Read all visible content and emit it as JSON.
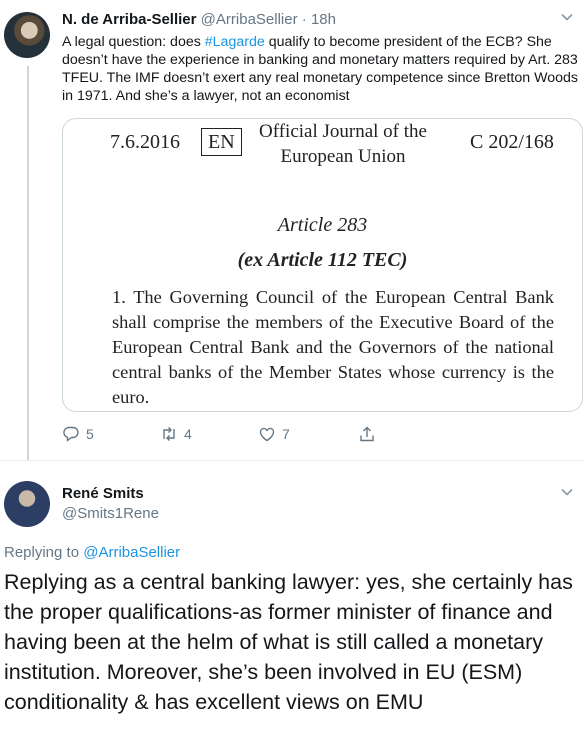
{
  "tweet1": {
    "name": "N. de Arriba-Sellier",
    "handle": "@ArribaSellier",
    "sep": " · ",
    "time": "18h",
    "text_a": "A legal question: does ",
    "hashtag": "#Lagarde",
    "text_b": " qualify to become president of the ECB? She doesn’t have the experience in banking and monetary matters required by Art. 283 TFEU. The IMF doesn’t exert any real monetary competence since Bretton Woods in 1971. And she’s a lawyer, not an economist",
    "image": {
      "date": "7.6.2016",
      "lang": "EN",
      "journal_line1": "Official Journal of the",
      "journal_line2": "European Union",
      "ref": "C 202/168",
      "article": "Article 283",
      "ex_article": "(ex Article 112 TEC)",
      "paragraph": "1.   The Governing Council of the European Central Bank shall comprise the members of the Executive Board of the European Central Bank and the Governors of the national central banks of the Member States whose currency is the euro."
    },
    "actions": {
      "replies": "5",
      "retweets": "4",
      "likes": "7"
    }
  },
  "tweet2": {
    "name": "René Smits",
    "handle": "@Smits1Rene",
    "replying_label": "Replying to ",
    "replying_to": "@ArribaSellier",
    "text": "Replying as a central banking lawyer: yes, she certainly has the proper qualifications-as former minister of finance and having been at the helm of what is still called a monetary institution. Moreover, she’s been involved in EU (ESM) conditionality & has excellent views on EMU"
  },
  "icons": [
    "reply-icon",
    "retweet-icon",
    "like-icon",
    "share-icon",
    "chevron-down-icon"
  ],
  "colors": {
    "link": "#1b95e0",
    "muted": "#657786",
    "border": "#ccd6dd"
  }
}
